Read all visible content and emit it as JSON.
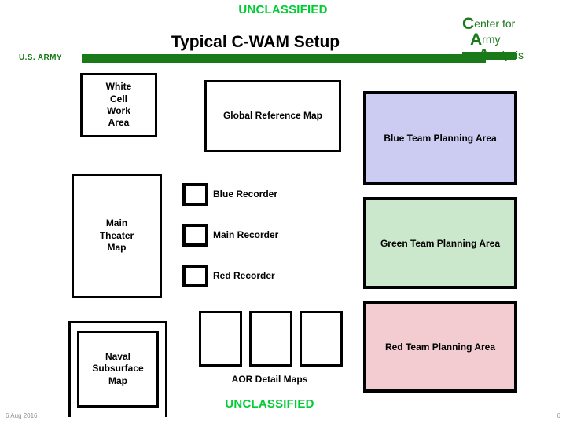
{
  "header": {
    "classification_top": "UNCLASSIFIED",
    "title": "Typical C-WAM Setup",
    "army_label": "U.S. ARMY",
    "logo": {
      "line1_cap": "C",
      "line1_rest": "enter for",
      "line2_cap": "A",
      "line2_rest": "rmy",
      "line3_cap": "A",
      "line3_rest": "nalysis"
    }
  },
  "diagram": {
    "white_cell": "White\nCell\nWork\nArea",
    "white_cell_lines": [
      "White",
      "Cell",
      "Work",
      "Area"
    ],
    "global_map": "Global Reference Map",
    "main_theater_lines": [
      "Main",
      "Theater",
      "Map"
    ],
    "naval_lines": [
      "Naval",
      "Subsurface",
      "Map"
    ],
    "recorders": [
      {
        "label": "Blue Recorder"
      },
      {
        "label": "Main Recorder"
      },
      {
        "label": "Red Recorder"
      }
    ],
    "aor_caption": "AOR Detail Maps",
    "aor_count": 3,
    "panels": [
      {
        "label": "Blue Team Planning Area",
        "fill": "#ccccf2"
      },
      {
        "label": "Green Team Planning Area",
        "fill": "#cce8cc"
      },
      {
        "label": "Red Team Planning Area",
        "fill": "#f2ccd1"
      }
    ]
  },
  "footer": {
    "classification_bottom": "UNCLASSIFIED",
    "date": "6 Aug 2016",
    "page_number": "6"
  },
  "colors": {
    "classification_green": "#00cc33",
    "army_green": "#1a7a1a",
    "outline": "#000000"
  }
}
